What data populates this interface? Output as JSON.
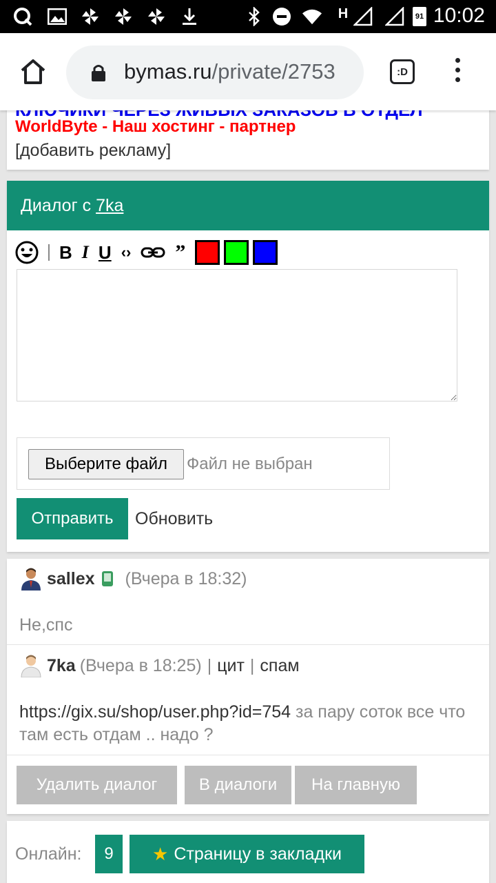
{
  "status_bar": {
    "time": "10:02",
    "icons": [
      "app-q-icon",
      "image-icon",
      "pinwheel-icon",
      "pinwheel-icon",
      "pinwheel-icon",
      "download-icon",
      "bluetooth-icon",
      "do-not-disturb-icon",
      "wifi-icon",
      "signal-h-icon",
      "signal-icon",
      "battery-91-icon"
    ],
    "signal_label": "H",
    "battery_label": "91"
  },
  "browser": {
    "domain": "bymas.ru",
    "path": "/private/2753",
    "tab_label": ":D"
  },
  "ad": {
    "cut_line": "КЛЮЧИКИ ЧЕРЕЗ ЖИВЫХ ЗАКАЗОВ В ОТДЕЛ",
    "partner": "WorldByte - Наш хостинг - партнер",
    "add_link": "[добавить рекламу]"
  },
  "dialog": {
    "title_prefix": "Диалог с ",
    "user": "7ka",
    "toolbar_colors": [
      "#ff0000",
      "#00ff00",
      "#0000ff"
    ],
    "file_button": "Выберите файл",
    "file_status": "Файл не выбран",
    "send": "Отправить",
    "refresh": "Обновить"
  },
  "messages": [
    {
      "author": "sallex",
      "time": "(Вчера в 18:32)",
      "text": "Не,спс"
    },
    {
      "author": "7ka",
      "time": "(Вчера в 18:25)",
      "sep1": "|",
      "quote": "цит",
      "sep2": "|",
      "spam": "спам",
      "link": "https://gix.su/shop/user.php?id=754",
      "text": " за пару соток все что там есть отдам .. надо ?"
    }
  ],
  "actions": {
    "delete": "Удалить диалог",
    "to_dialogs": "В диалоги",
    "home": "На главную"
  },
  "footer": {
    "online_label": "Онлайн:",
    "online_count": "9",
    "bookmark": "Страницу в закладки"
  },
  "colors": {
    "accent": "#128f74",
    "ad_red": "#ff0000",
    "gray_button": "#bdbdbd"
  }
}
